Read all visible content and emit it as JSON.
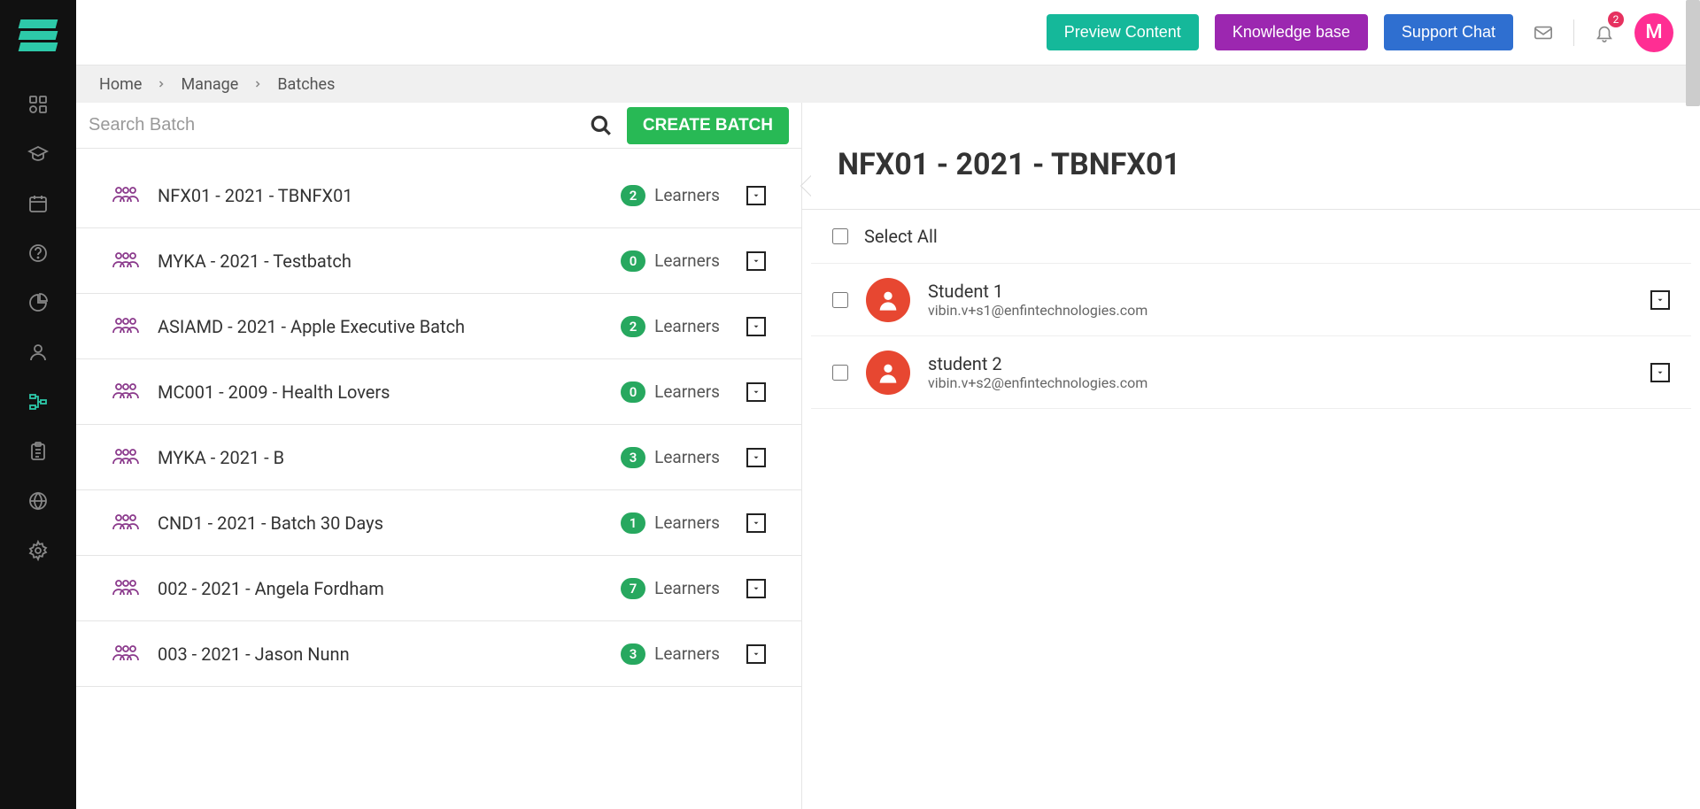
{
  "header": {
    "preview": "Preview Content",
    "kb": "Knowledge base",
    "support": "Support Chat",
    "notif_count": "2",
    "avatar_letter": "M"
  },
  "breadcrumb": {
    "home": "Home",
    "manage": "Manage",
    "batches": "Batches"
  },
  "search": {
    "placeholder": "Search Batch",
    "create": "CREATE BATCH"
  },
  "batches": [
    {
      "name": "NFX01 - 2021 - TBNFX01",
      "count": "2",
      "learners": "Learners"
    },
    {
      "name": "MYKA - 2021 - Testbatch",
      "count": "0",
      "learners": "Learners"
    },
    {
      "name": "ASIAMD - 2021 - Apple Executive Batch",
      "count": "2",
      "learners": "Learners"
    },
    {
      "name": "MC001 - 2009 - Health Lovers",
      "count": "0",
      "learners": "Learners"
    },
    {
      "name": "MYKA - 2021 - B",
      "count": "3",
      "learners": "Learners"
    },
    {
      "name": "CND1 - 2021 - Batch 30 Days",
      "count": "1",
      "learners": "Learners"
    },
    {
      "name": "002 - 2021 - Angela Fordham",
      "count": "7",
      "learners": "Learners"
    },
    {
      "name": "003 - 2021 - Jason Nunn",
      "count": "3",
      "learners": "Learners"
    }
  ],
  "detail": {
    "title": "NFX01 - 2021 - TBNFX01",
    "select_all": "Select All"
  },
  "students": [
    {
      "name": "Student 1",
      "email": "vibin.v+s1@enfintechnologies.com"
    },
    {
      "name": "student 2",
      "email": "vibin.v+s2@enfintechnologies.com"
    }
  ]
}
